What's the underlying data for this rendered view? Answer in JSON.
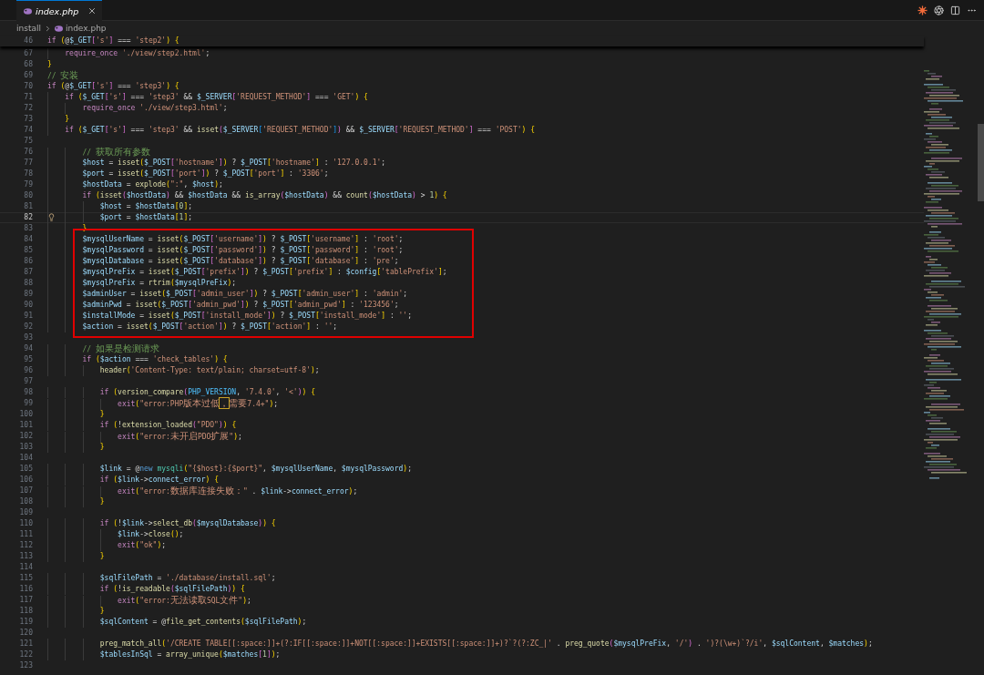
{
  "tab": {
    "label": "index.php",
    "selected": true
  },
  "breadcrumb": [
    "install",
    "index.php"
  ],
  "sticky_line": {
    "n": "46",
    "code": "if (@$_GET['s'] === 'step2') {"
  },
  "blocks": [
    {
      "boxed": false,
      "lines": [
        {
          "n": "67",
          "code": "    require_once './view/step2.html';",
          "current": false
        },
        {
          "n": "68",
          "code": "}",
          "current": false
        },
        {
          "n": "69",
          "code": "// 安装",
          "current": false
        },
        {
          "n": "70",
          "code": "if (@$_GET['s'] === 'step3') {",
          "current": false
        },
        {
          "n": "71",
          "code": "    if ($_GET['s'] === 'step3' && $_SERVER['REQUEST_METHOD'] === 'GET') {",
          "current": false
        },
        {
          "n": "72",
          "code": "        require_once './view/step3.html';",
          "current": false
        },
        {
          "n": "73",
          "code": "    }",
          "current": false
        },
        {
          "n": "74",
          "code": "    if ($_GET['s'] === 'step3' && isset($_SERVER['REQUEST_METHOD']) && $_SERVER['REQUEST_METHOD'] === 'POST') {",
          "current": false
        },
        {
          "n": "75",
          "current": false
        },
        {
          "n": "76",
          "code": "        // 获取所有参数",
          "current": false
        },
        {
          "n": "77",
          "code": "        $host = isset($_POST['hostname']) ? $_POST['hostname'] : '127.0.0.1';",
          "current": false
        },
        {
          "n": "78",
          "code": "        $port = isset($_POST['port']) ? $_POST['port'] : '3306';",
          "current": false
        },
        {
          "n": "79",
          "code": "        $hostData = explode(\":\", $host);",
          "current": false
        },
        {
          "n": "80",
          "code": "        if (isset($hostData) && $hostData && is_array($hostData) && count($hostData) > 1) {",
          "current": false
        },
        {
          "n": "81",
          "code": "            $host = $hostData[0];",
          "current": false
        },
        {
          "n": "82",
          "code": "            $port = $hostData[1];",
          "current": true
        },
        {
          "n": "83",
          "code": "        }",
          "current": false
        }
      ]
    },
    {
      "boxed": true,
      "lines": [
        {
          "n": "84",
          "code": "        $mysqlUserName = isset($_POST['username']) ? $_POST['username'] : 'root';",
          "current": false
        },
        {
          "n": "85",
          "code": "        $mysqlPassword = isset($_POST['password']) ? $_POST['password'] : 'root';",
          "current": false
        },
        {
          "n": "86",
          "code": "        $mysqlDatabase = isset($_POST['database']) ? $_POST['database'] : 'pre';",
          "current": false
        },
        {
          "n": "87",
          "code": "        $mysqlPreFix = isset($_POST['prefix']) ? $_POST['prefix'] : $config['tablePrefix'];",
          "current": false
        },
        {
          "n": "88",
          "code": "        $mysqlPreFix = rtrim($mysqlPreFix);",
          "current": false
        },
        {
          "n": "89",
          "code": "        $adminUser = isset($_POST['admin_user']) ? $_POST['admin_user'] : 'admin';",
          "current": false
        },
        {
          "n": "90",
          "code": "        $adminPwd = isset($_POST['admin_pwd']) ? $_POST['admin_pwd'] : '123456';",
          "current": false
        },
        {
          "n": "91",
          "code": "        $installMode = isset($_POST['install_mode']) ? $_POST['install_mode'] : '';",
          "current": false
        },
        {
          "n": "92",
          "code": "        $action = isset($_POST['action']) ? $_POST['action'] : '';",
          "current": false
        }
      ]
    },
    {
      "boxed": false,
      "lines": [
        {
          "n": "93",
          "current": false
        },
        {
          "n": "94",
          "code": "        // 如果是检测请求",
          "current": false
        },
        {
          "n": "95",
          "code": "        if ($action === 'check_tables') {",
          "current": false
        },
        {
          "n": "96",
          "code": "            header('Content-Type: text/plain; charset=utf-8');",
          "current": false
        },
        {
          "n": "97",
          "current": false
        },
        {
          "n": "98",
          "code": "            if (version_compare(PHP_VERSION, '7.4.0', '<')) {",
          "current": false
        },
        {
          "n": "99",
          "code": "                exit(\"error:PHP版本过低，需要7.4+\");",
          "current": false
        },
        {
          "n": "100",
          "code": "            }",
          "current": false
        },
        {
          "n": "101",
          "code": "            if (!extension_loaded(\"PDO\")) {",
          "current": false
        },
        {
          "n": "102",
          "code": "                exit(\"error:未开启PDO扩展\");",
          "current": false
        },
        {
          "n": "103",
          "code": "            }",
          "current": false
        },
        {
          "n": "104",
          "current": false
        },
        {
          "n": "105",
          "code": "            $link = @new mysqli(\"{$host}:{$port}\", $mysqlUserName, $mysqlPassword);",
          "current": false
        },
        {
          "n": "106",
          "code": "            if ($link->connect_error) {",
          "current": false
        },
        {
          "n": "107",
          "code": "                exit(\"error:数据库连接失败：\" . $link->connect_error);",
          "current": false
        },
        {
          "n": "108",
          "code": "            }",
          "current": false
        },
        {
          "n": "109",
          "current": false
        },
        {
          "n": "110",
          "code": "            if (!$link->select_db($mysqlDatabase)) {",
          "current": false
        },
        {
          "n": "111",
          "code": "                $link->close();",
          "current": false
        },
        {
          "n": "112",
          "code": "                exit(\"ok\");",
          "current": false
        },
        {
          "n": "113",
          "code": "            }",
          "current": false
        },
        {
          "n": "114",
          "current": false
        },
        {
          "n": "115",
          "code": "            $sqlFilePath = './database/install.sql';",
          "current": false
        },
        {
          "n": "116",
          "code": "            if (!is_readable($sqlFilePath)) {",
          "current": false
        },
        {
          "n": "117",
          "code": "                exit(\"error:无法读取SQL文件\");",
          "current": false
        },
        {
          "n": "118",
          "code": "            }",
          "current": false
        },
        {
          "n": "119",
          "code": "            $sqlContent = @file_get_contents($sqlFilePath);",
          "current": false
        },
        {
          "n": "120",
          "current": false
        },
        {
          "n": "121",
          "code": "            preg_match_all('/CREATE TABLE[[:space:]]+(?:IF[[:space:]]+NOT[[:space:]]+EXISTS[[:space:]]+)?`?(?:ZC_|' . preg_quote($mysqlPreFix, '/') . ')?(\\w+)`?/i', $sqlContent, $matches);",
          "current": false
        },
        {
          "n": "122",
          "code": "            $tablesInSql = array_unique($matches[1]);",
          "current": false
        },
        {
          "n": "123",
          "current": false
        }
      ]
    }
  ]
}
